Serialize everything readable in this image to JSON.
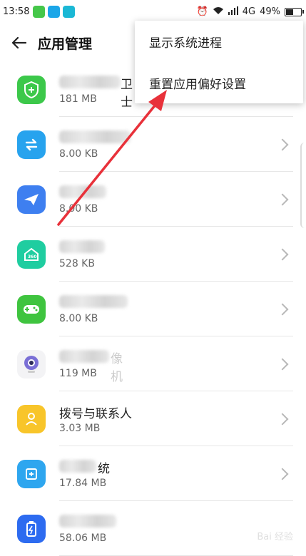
{
  "status_bar": {
    "time": "13:58",
    "signal_text": "4G",
    "battery": "49%",
    "battery_level": 0.49
  },
  "header": {
    "back_icon": "arrow-left-icon",
    "title": "应用管理"
  },
  "menu": {
    "items": [
      {
        "label": "显示系统进程"
      },
      {
        "label": "重置应用偏好设置"
      }
    ]
  },
  "apps": [
    {
      "name_suffix": "卫士",
      "size": "181 MB",
      "icon": "shield-icon",
      "color": "#3cc84a"
    },
    {
      "name_suffix": "",
      "size": "8.00 KB",
      "icon": "swap-icon",
      "color": "#27a3ee"
    },
    {
      "name_suffix": "",
      "size": "8.00 KB",
      "icon": "paper-plane-icon",
      "color": "#3e7ff0"
    },
    {
      "name_suffix": "",
      "size": "528 KB",
      "icon": "home-360-icon",
      "color": "#1fcda0"
    },
    {
      "name_suffix": "",
      "size": "8.00 KB",
      "icon": "gamepad-icon",
      "color": "#3fc43f"
    },
    {
      "name_suffix": "像机",
      "size": "119 MB",
      "icon": "camera-icon",
      "color": "#f3f3f5"
    },
    {
      "name_suffix": "拨号与联系人",
      "size": "3.03 MB",
      "icon": "contact-icon",
      "color": "#f8c52a"
    },
    {
      "name_suffix": "统",
      "size": "17.84 MB",
      "icon": "system-icon",
      "color": "#2ea6ef"
    },
    {
      "name_suffix": "",
      "size": "58.06 MB",
      "icon": "battery-icon",
      "color": "#2d6bf0"
    }
  ],
  "watermark": "Bai 经验"
}
